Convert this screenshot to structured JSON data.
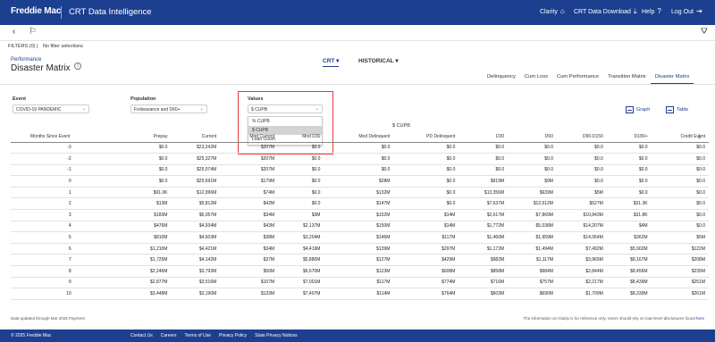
{
  "topnav": {
    "logo": "Freddie Mac",
    "app_title": "CRT Data Intelligence",
    "items": [
      {
        "label": "Clarity",
        "icon": "home-icon"
      },
      {
        "label": "CRT Data Download",
        "icon": "download-icon"
      },
      {
        "label": "Help",
        "icon": "help-icon"
      },
      {
        "label": "Log Out",
        "icon": "logout-icon"
      }
    ]
  },
  "filters": {
    "count": "FILTERS (0)",
    "text": "No filter selections"
  },
  "header": {
    "section": "Performance",
    "title": "Disaster Matrix",
    "switch_crt": "CRT",
    "switch_historical": "HISTORICAL"
  },
  "tabs": [
    "Delinquency",
    "Cum Loss",
    "Cum Performance",
    "Transition Matrix",
    "Disaster Matrix"
  ],
  "controls": {
    "event_label": "Event",
    "event_value": "COVID-19 PANDEMIC",
    "population_label": "Population",
    "population_value": "Forbearance and D60+",
    "values_label": "Values",
    "values_value": "$ CUPB",
    "values_options": [
      "% CUPB",
      "$ CUPB",
      "Loan Count"
    ],
    "graph_label": "Graph",
    "table_label": "Table"
  },
  "table": {
    "title": "$ CUPB",
    "columns": [
      "Months Since Event",
      "Prepay",
      "Current",
      "Mod Current",
      "Mod D30",
      "Mod Delinquent",
      "PD Delinquent",
      "D30",
      "D60",
      "D90-D150",
      "D180+",
      "Credit Event"
    ],
    "rows": [
      [
        "-3",
        "$0.0",
        "$23,242M",
        "$207M",
        "$0.0",
        "$0.0",
        "$0.0",
        "$0.0",
        "$0.0",
        "$0.0",
        "$0.0",
        "$0.0"
      ],
      [
        "-2",
        "$0.0",
        "$25,327M",
        "$207M",
        "$0.0",
        "$0.0",
        "$0.0",
        "$0.0",
        "$0.0",
        "$0.0",
        "$0.0",
        "$0.0"
      ],
      [
        "-1",
        "$0.0",
        "$25,074M",
        "$207M",
        "$0.0",
        "$0.0",
        "$0.0",
        "$0.0",
        "$0.0",
        "$0.0",
        "$0.0",
        "$0.0"
      ],
      [
        "0",
        "$0.0",
        "$25,691M",
        "$179M",
        "$0.0",
        "$28M",
        "$0.0",
        "$919M",
        "$9M",
        "$0.0",
        "$0.0",
        "$0.0"
      ],
      [
        "1",
        "$91.0K",
        "$12,996M",
        "$74M",
        "$0.0",
        "$132M",
        "$0.0",
        "$13,356M",
        "$639M",
        "$5M",
        "$0.0",
        "$0.0"
      ],
      [
        "2",
        "$13M",
        "$5,812M",
        "$42M",
        "$0.0",
        "$147M",
        "$0.0",
        "$7,637M",
        "$12,612M",
        "$527M",
        "$31.3K",
        "$0.0"
      ],
      [
        "3",
        "$183M",
        "$5,057M",
        "$34M",
        "$3M",
        "$152M",
        "$14M",
        "$2,617M",
        "$7,869M",
        "$10,843M",
        "$31.8K",
        "$0.0"
      ],
      [
        "4",
        "$476M",
        "$4,934M",
        "$43M",
        "$2,137M",
        "$150M",
        "$14M",
        "$1,772M",
        "$5,038M",
        "$14,207M",
        "$4M",
        "$0.0"
      ],
      [
        "5",
        "$810M",
        "$4,603M",
        "$38M",
        "$3,204M",
        "$146M",
        "$117M",
        "$1,460M",
        "$1,959M",
        "$14,064M",
        "$362M",
        "$5M"
      ],
      [
        "6",
        "$1,210M",
        "$4,421M",
        "$34M",
        "$4,419M",
        "$139M",
        "$297M",
        "$1,172M",
        "$1,494M",
        "$7,492M",
        "$5,902M",
        "$122M"
      ],
      [
        "7",
        "$1,725M",
        "$4,142M",
        "$37M",
        "$5,880M",
        "$127M",
        "$429M",
        "$982M",
        "$1,117M",
        "$3,965M",
        "$8,167M",
        "$208M"
      ],
      [
        "8",
        "$2,246M",
        "$3,793M",
        "$50M",
        "$6,670M",
        "$123M",
        "$608M",
        "$858M",
        "$984M",
        "$2,844M",
        "$8,456M",
        "$235M"
      ],
      [
        "9",
        "$2,877M",
        "$3,516M",
        "$107M",
        "$7,001M",
        "$117M",
        "$774M",
        "$716M",
        "$757M",
        "$2,217M",
        "$8,439M",
        "$251M"
      ],
      [
        "10",
        "$3,448M",
        "$3,190M",
        "$133M",
        "$7,407M",
        "$114M",
        "$764M",
        "$603M",
        "$690M",
        "$1,799M",
        "$8,339M",
        "$261M"
      ]
    ]
  },
  "notes": {
    "left": "Data updated through Mar 2025 Payment",
    "right_text": "The information on Clarity is for reference only. Users should rely on loan-level disclosures found",
    "right_link": "here"
  },
  "footer": {
    "copyright": "© 2025 Freddie Mac",
    "links": [
      "Contact Us",
      "Careers",
      "Terms of Use",
      "Privacy Policy",
      "State Privacy Notices"
    ]
  },
  "colors": {
    "brand": "#1c3f8f",
    "highlight": "#e53935"
  }
}
